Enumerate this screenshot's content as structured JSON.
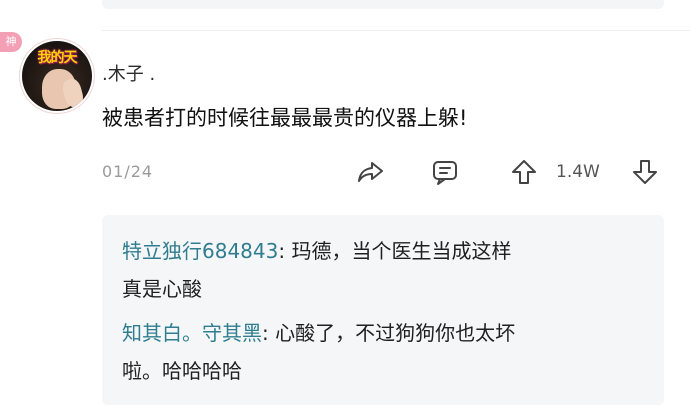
{
  "comment": {
    "username": ".木子 .",
    "badge": "神",
    "avatar_sticker": "我的天",
    "text": "被患者打的时候往最最最贵的仪器上躲!",
    "date": "01/24",
    "like_count": "1.4W",
    "icons": {
      "share": "share-icon",
      "reply": "reply-bubble-icon",
      "upvote": "upvote-icon",
      "downvote": "downvote-icon"
    }
  },
  "replies": [
    {
      "name": "特立独行684843",
      "separator": ":",
      "text_line1": "玛德，当个医生当成这样",
      "text_line2": "真是心酸"
    },
    {
      "name": "知其白。守其黑",
      "separator": ":",
      "text_line1": "心酸了，不过狗狗你也太坏",
      "text_line2": "啦。哈哈哈哈"
    }
  ],
  "colors": {
    "reply_name": "#2f7d8f",
    "reply_background": "#f5f6f8",
    "badge": "#f3a0b7",
    "date": "#9a9a9a"
  }
}
